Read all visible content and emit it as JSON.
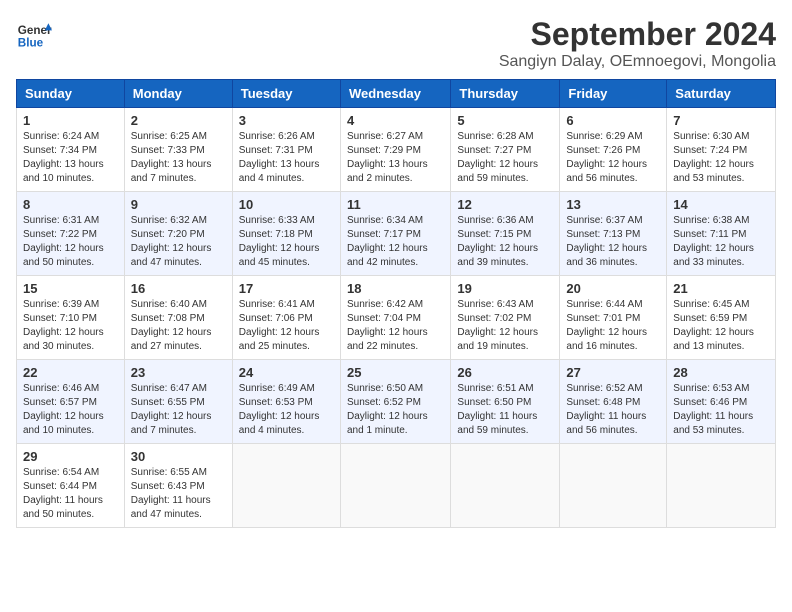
{
  "header": {
    "logo_line1": "General",
    "logo_line2": "Blue",
    "month_title": "September 2024",
    "location": "Sangiyn Dalay, OEmnoegovi, Mongolia"
  },
  "weekdays": [
    "Sunday",
    "Monday",
    "Tuesday",
    "Wednesday",
    "Thursday",
    "Friday",
    "Saturday"
  ],
  "weeks": [
    [
      {
        "day": "1",
        "text": "Sunrise: 6:24 AM\nSunset: 7:34 PM\nDaylight: 13 hours and 10 minutes."
      },
      {
        "day": "2",
        "text": "Sunrise: 6:25 AM\nSunset: 7:33 PM\nDaylight: 13 hours and 7 minutes."
      },
      {
        "day": "3",
        "text": "Sunrise: 6:26 AM\nSunset: 7:31 PM\nDaylight: 13 hours and 4 minutes."
      },
      {
        "day": "4",
        "text": "Sunrise: 6:27 AM\nSunset: 7:29 PM\nDaylight: 13 hours and 2 minutes."
      },
      {
        "day": "5",
        "text": "Sunrise: 6:28 AM\nSunset: 7:27 PM\nDaylight: 12 hours and 59 minutes."
      },
      {
        "day": "6",
        "text": "Sunrise: 6:29 AM\nSunset: 7:26 PM\nDaylight: 12 hours and 56 minutes."
      },
      {
        "day": "7",
        "text": "Sunrise: 6:30 AM\nSunset: 7:24 PM\nDaylight: 12 hours and 53 minutes."
      }
    ],
    [
      {
        "day": "8",
        "text": "Sunrise: 6:31 AM\nSunset: 7:22 PM\nDaylight: 12 hours and 50 minutes."
      },
      {
        "day": "9",
        "text": "Sunrise: 6:32 AM\nSunset: 7:20 PM\nDaylight: 12 hours and 47 minutes."
      },
      {
        "day": "10",
        "text": "Sunrise: 6:33 AM\nSunset: 7:18 PM\nDaylight: 12 hours and 45 minutes."
      },
      {
        "day": "11",
        "text": "Sunrise: 6:34 AM\nSunset: 7:17 PM\nDaylight: 12 hours and 42 minutes."
      },
      {
        "day": "12",
        "text": "Sunrise: 6:36 AM\nSunset: 7:15 PM\nDaylight: 12 hours and 39 minutes."
      },
      {
        "day": "13",
        "text": "Sunrise: 6:37 AM\nSunset: 7:13 PM\nDaylight: 12 hours and 36 minutes."
      },
      {
        "day": "14",
        "text": "Sunrise: 6:38 AM\nSunset: 7:11 PM\nDaylight: 12 hours and 33 minutes."
      }
    ],
    [
      {
        "day": "15",
        "text": "Sunrise: 6:39 AM\nSunset: 7:10 PM\nDaylight: 12 hours and 30 minutes."
      },
      {
        "day": "16",
        "text": "Sunrise: 6:40 AM\nSunset: 7:08 PM\nDaylight: 12 hours and 27 minutes."
      },
      {
        "day": "17",
        "text": "Sunrise: 6:41 AM\nSunset: 7:06 PM\nDaylight: 12 hours and 25 minutes."
      },
      {
        "day": "18",
        "text": "Sunrise: 6:42 AM\nSunset: 7:04 PM\nDaylight: 12 hours and 22 minutes."
      },
      {
        "day": "19",
        "text": "Sunrise: 6:43 AM\nSunset: 7:02 PM\nDaylight: 12 hours and 19 minutes."
      },
      {
        "day": "20",
        "text": "Sunrise: 6:44 AM\nSunset: 7:01 PM\nDaylight: 12 hours and 16 minutes."
      },
      {
        "day": "21",
        "text": "Sunrise: 6:45 AM\nSunset: 6:59 PM\nDaylight: 12 hours and 13 minutes."
      }
    ],
    [
      {
        "day": "22",
        "text": "Sunrise: 6:46 AM\nSunset: 6:57 PM\nDaylight: 12 hours and 10 minutes."
      },
      {
        "day": "23",
        "text": "Sunrise: 6:47 AM\nSunset: 6:55 PM\nDaylight: 12 hours and 7 minutes."
      },
      {
        "day": "24",
        "text": "Sunrise: 6:49 AM\nSunset: 6:53 PM\nDaylight: 12 hours and 4 minutes."
      },
      {
        "day": "25",
        "text": "Sunrise: 6:50 AM\nSunset: 6:52 PM\nDaylight: 12 hours and 1 minute."
      },
      {
        "day": "26",
        "text": "Sunrise: 6:51 AM\nSunset: 6:50 PM\nDaylight: 11 hours and 59 minutes."
      },
      {
        "day": "27",
        "text": "Sunrise: 6:52 AM\nSunset: 6:48 PM\nDaylight: 11 hours and 56 minutes."
      },
      {
        "day": "28",
        "text": "Sunrise: 6:53 AM\nSunset: 6:46 PM\nDaylight: 11 hours and 53 minutes."
      }
    ],
    [
      {
        "day": "29",
        "text": "Sunrise: 6:54 AM\nSunset: 6:44 PM\nDaylight: 11 hours and 50 minutes."
      },
      {
        "day": "30",
        "text": "Sunrise: 6:55 AM\nSunset: 6:43 PM\nDaylight: 11 hours and 47 minutes."
      },
      {
        "day": "",
        "text": ""
      },
      {
        "day": "",
        "text": ""
      },
      {
        "day": "",
        "text": ""
      },
      {
        "day": "",
        "text": ""
      },
      {
        "day": "",
        "text": ""
      }
    ]
  ]
}
